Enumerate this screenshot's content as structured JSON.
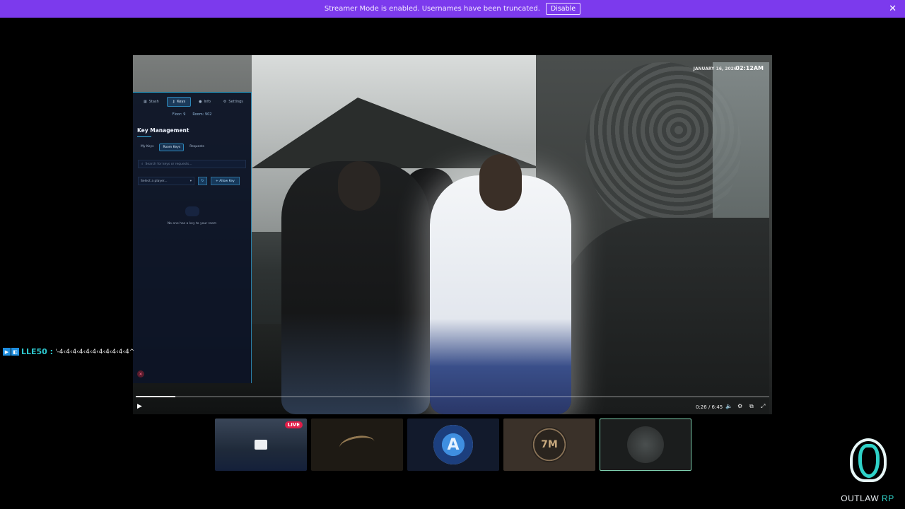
{
  "banner": {
    "message": "Streamer Mode is enabled. Usernames have been truncated.",
    "disable_label": "Disable",
    "close_glyph": "✕",
    "color": "#7c3aed"
  },
  "hud": {
    "date": "JANUARY 16, 2026",
    "time": "02:12AM"
  },
  "tablet": {
    "tabs": [
      {
        "label": "Stash",
        "icon": "box-icon"
      },
      {
        "label": "Keys",
        "icon": "key-icon",
        "active": true
      },
      {
        "label": "Info",
        "icon": "info-icon"
      },
      {
        "label": "Settings",
        "icon": "gear-icon"
      }
    ],
    "stats": {
      "floor": "Floor: 9",
      "room": "Room: 902"
    },
    "heading": "Key Management",
    "subtabs": [
      {
        "label": "My Keys"
      },
      {
        "label": "Room Keys",
        "active": true
      },
      {
        "label": "Requests"
      }
    ],
    "search_placeholder": "Search for keys or requests...",
    "select_placeholder": "Select a player...",
    "allow_label": "Allow Key",
    "empty_message": "No one has a key to your room"
  },
  "player": {
    "time": "0:26 / 6:45",
    "progress": 0.063,
    "play_glyph": "▶"
  },
  "thumbnails": [
    {
      "name": "thumb-live-stream",
      "live_label": "LIVE"
    },
    {
      "name": "thumb-logo-2"
    },
    {
      "name": "thumb-logo-a",
      "logo_text": "A"
    },
    {
      "name": "thumb-logo-7m",
      "logo_text": "7M"
    },
    {
      "name": "thumb-selected",
      "selected": true
    }
  ],
  "chat": {
    "user": "LLE50 :",
    "message": "'-4‹4‹4‹4‹4‹4‹4‹4‹4‹4‹4^"
  },
  "brand": {
    "name": "OUTLAW",
    "suffix": "RP"
  }
}
